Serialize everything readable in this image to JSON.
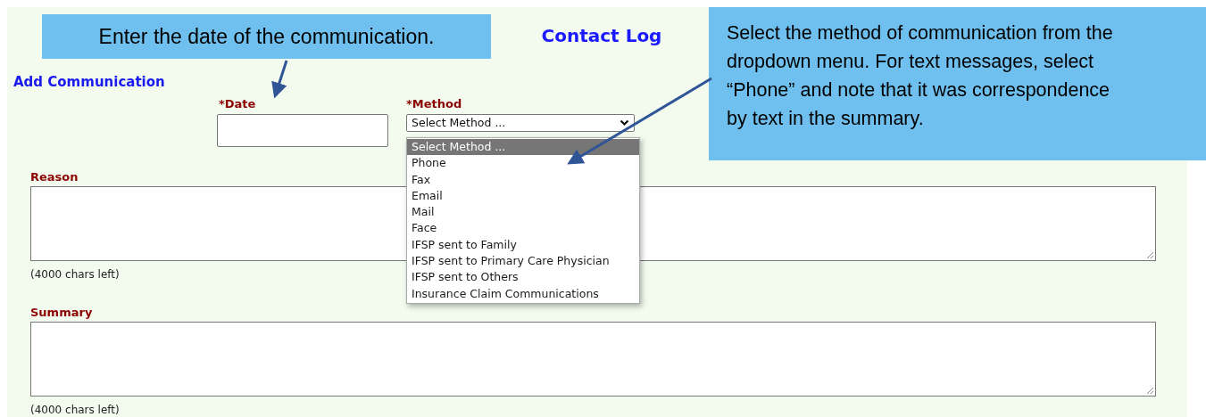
{
  "header": {
    "title": "Contact Log"
  },
  "section_title": "Add Communication",
  "date": {
    "label": "*Date"
  },
  "method": {
    "label": "*Method",
    "value": "Select Method ...",
    "expanded": true,
    "options": [
      {
        "label": "Select Method ...",
        "selected": true
      },
      {
        "label": "Phone",
        "selected": false
      },
      {
        "label": "Fax",
        "selected": false
      },
      {
        "label": "Email",
        "selected": false
      },
      {
        "label": "Mail",
        "selected": false
      },
      {
        "label": "Face",
        "selected": false
      },
      {
        "label": "IFSP sent to Family",
        "selected": false
      },
      {
        "label": "IFSP sent to Primary Care Physician",
        "selected": false
      },
      {
        "label": "IFSP sent to Others",
        "selected": false
      },
      {
        "label": "Insurance Claim Communications",
        "selected": false
      }
    ]
  },
  "reason": {
    "label": "Reason",
    "counter": "(4000 chars left)"
  },
  "summary": {
    "label": "Summary",
    "counter": "(4000 chars left)"
  },
  "callouts": [
    {
      "text": "Enter the date of the communication."
    },
    {
      "text": "Select the method of communication from the dropdown menu. For text messages, select “Phone” and note that it was correspondence by text in the summary."
    }
  ]
}
